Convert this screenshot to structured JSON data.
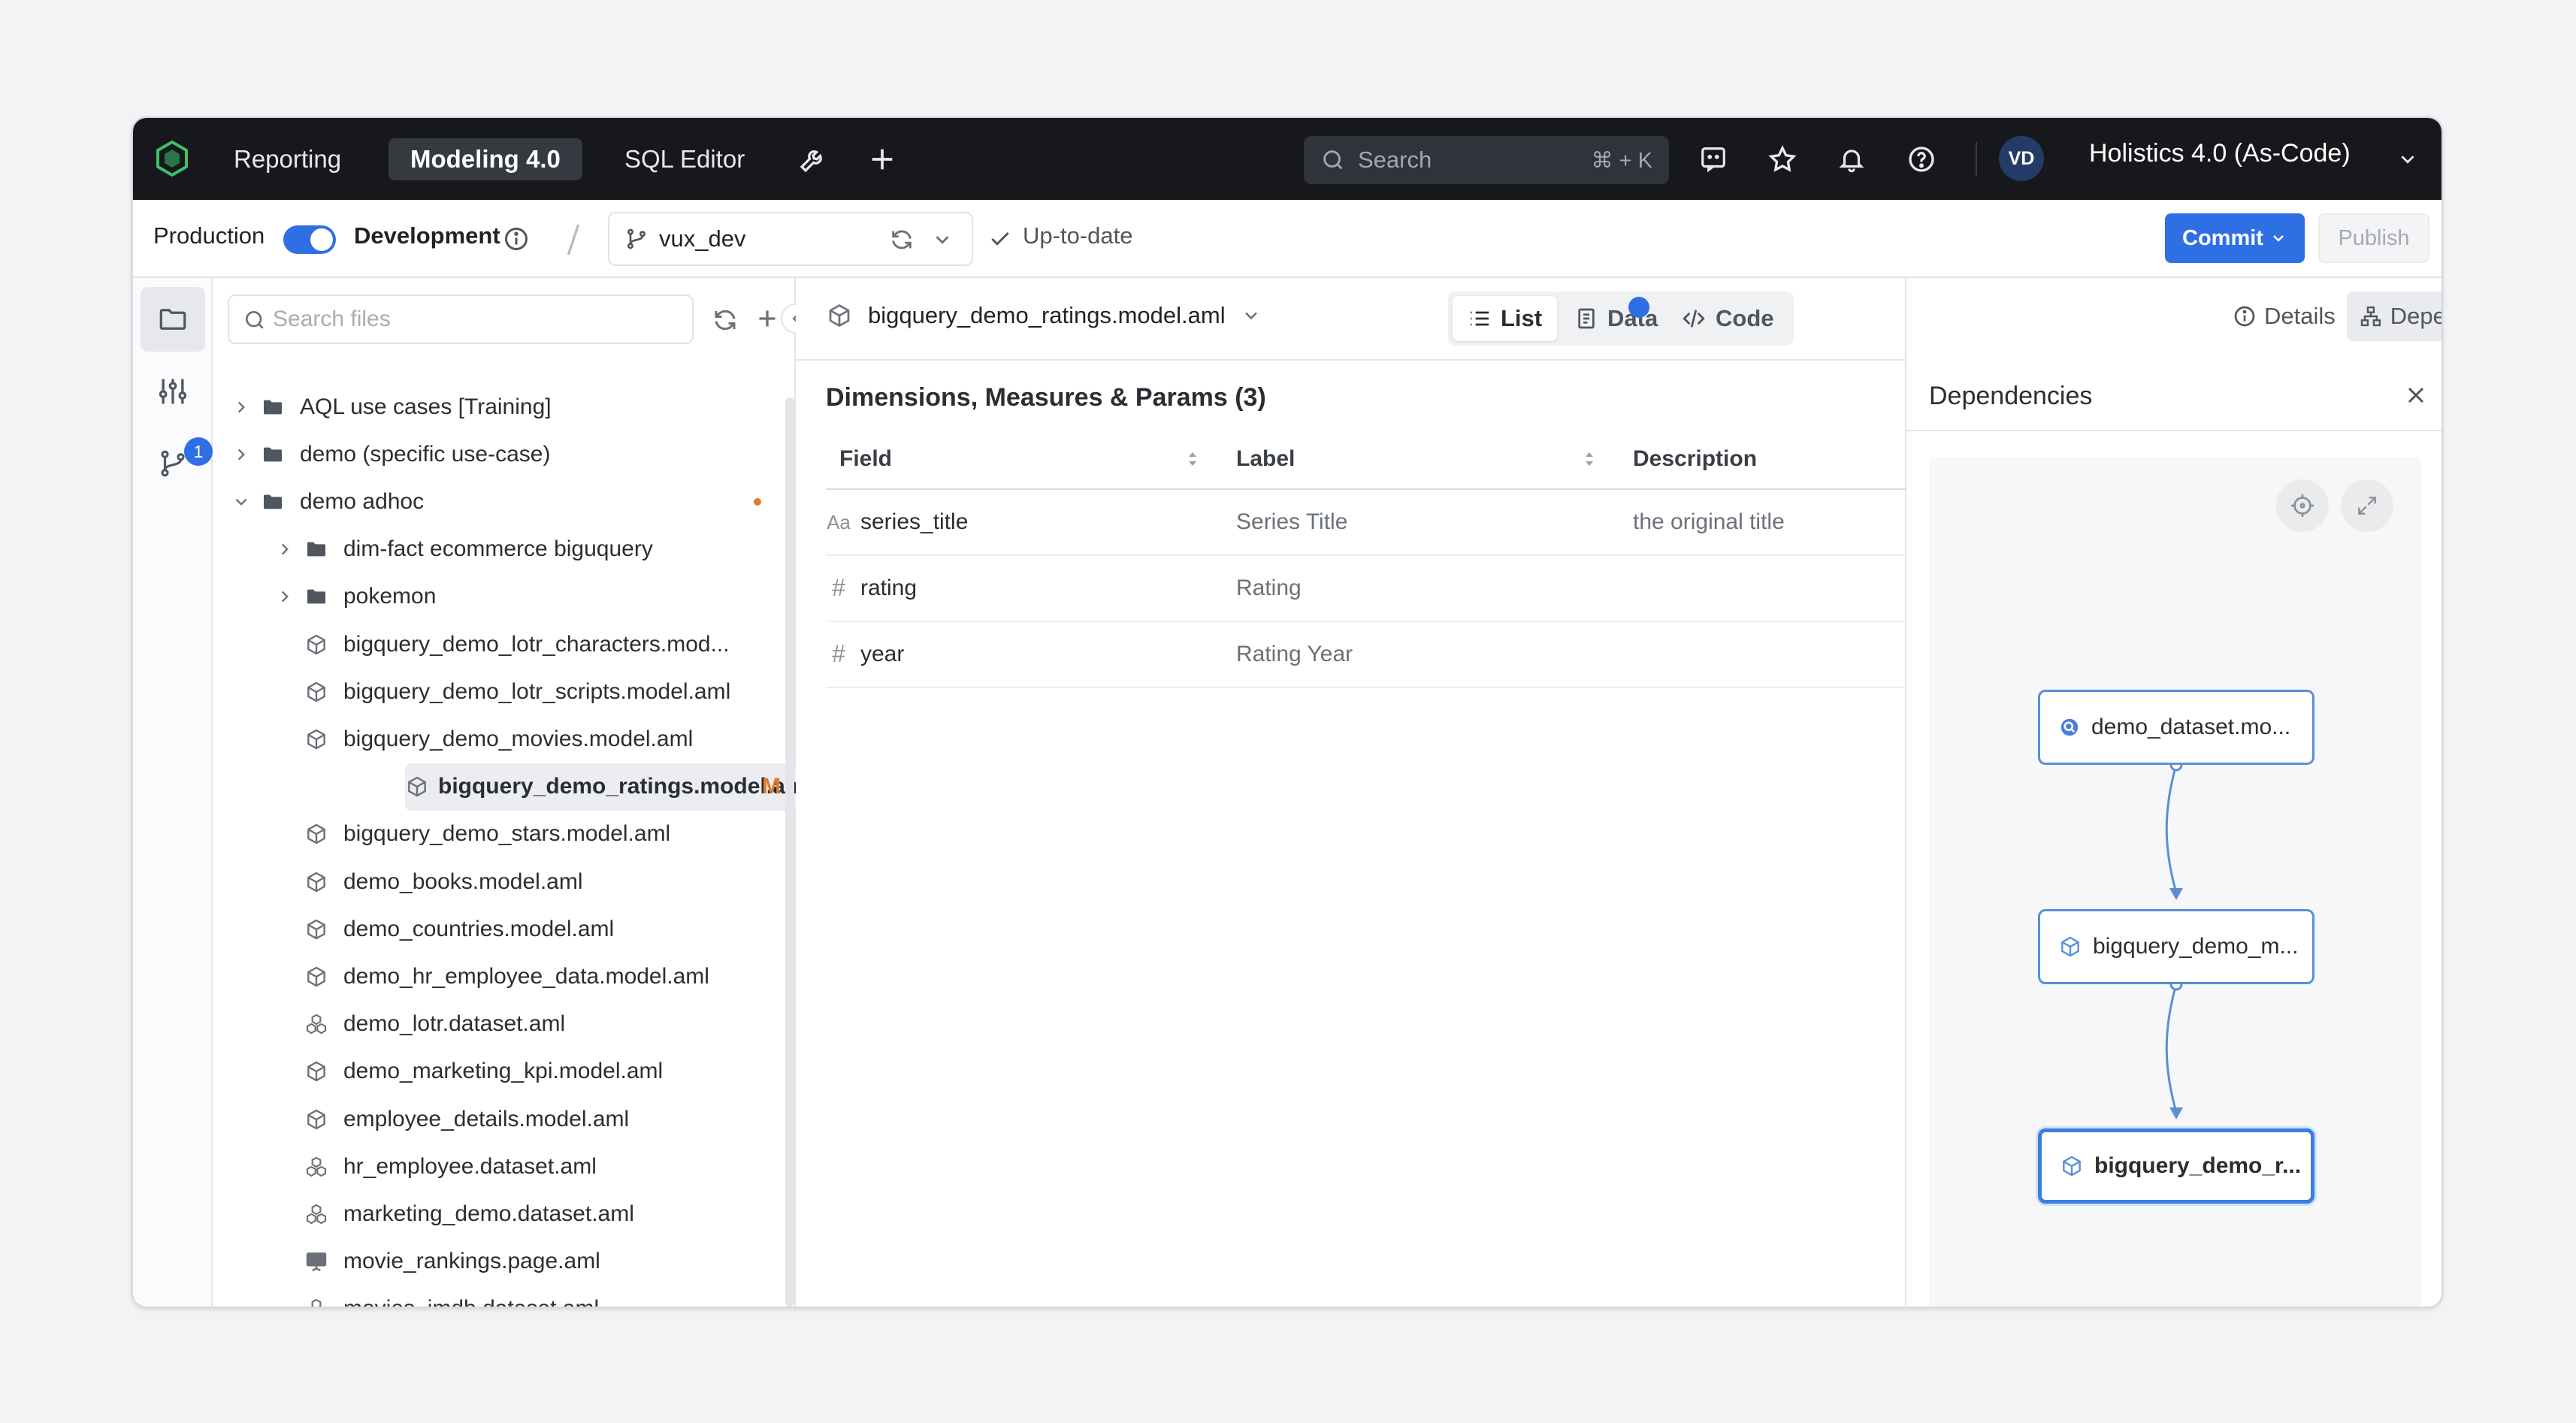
{
  "nav": {
    "tabs": [
      "Reporting",
      "Modeling 4.0",
      "SQL Editor"
    ],
    "active_tab": "Modeling 4.0",
    "search_placeholder": "Search",
    "search_shortcut": "⌘ + K",
    "avatar_initials": "VD",
    "workspace": "Holistics 4.0 (As-Code)"
  },
  "toolbar": {
    "production_label": "Production",
    "development_label": "Development",
    "branch": "vux_dev",
    "status": "Up-to-date",
    "commit_label": "Commit",
    "publish_label": "Publish"
  },
  "rail": {
    "badge_count": "1"
  },
  "files": {
    "search_placeholder": "Search files",
    "items": [
      {
        "name": "AQL use cases [Training]",
        "type": "folder",
        "level": 0,
        "expanded": false
      },
      {
        "name": "demo (specific use-case)",
        "type": "folder",
        "level": 0,
        "expanded": false
      },
      {
        "name": "demo adhoc",
        "type": "folder",
        "level": 0,
        "expanded": true,
        "modified_dot": true
      },
      {
        "name": "dim-fact ecommerce biguquery",
        "type": "folder",
        "level": 1,
        "expanded": false
      },
      {
        "name": "pokemon",
        "type": "folder",
        "level": 1,
        "expanded": false
      },
      {
        "name": "bigquery_demo_lotr_characters.mod...",
        "type": "model",
        "level": 1
      },
      {
        "name": "bigquery_demo_lotr_scripts.model.aml",
        "type": "model",
        "level": 1
      },
      {
        "name": "bigquery_demo_movies.model.aml",
        "type": "model",
        "level": 1
      },
      {
        "name": "bigquery_demo_ratings.model.aml",
        "type": "model",
        "level": 1,
        "selected": true,
        "flag": "M"
      },
      {
        "name": "bigquery_demo_stars.model.aml",
        "type": "model",
        "level": 1
      },
      {
        "name": "demo_books.model.aml",
        "type": "model",
        "level": 1
      },
      {
        "name": "demo_countries.model.aml",
        "type": "model",
        "level": 1
      },
      {
        "name": "demo_hr_employee_data.model.aml",
        "type": "model",
        "level": 1
      },
      {
        "name": "demo_lotr.dataset.aml",
        "type": "dataset",
        "level": 1
      },
      {
        "name": "demo_marketing_kpi.model.aml",
        "type": "model",
        "level": 1
      },
      {
        "name": "employee_details.model.aml",
        "type": "model",
        "level": 1
      },
      {
        "name": "hr_employee.dataset.aml",
        "type": "dataset",
        "level": 1
      },
      {
        "name": "marketing_demo.dataset.aml",
        "type": "dataset",
        "level": 1
      },
      {
        "name": "movie_rankings.page.aml",
        "type": "page",
        "level": 1
      },
      {
        "name": "movies_imdb.dataset.aml",
        "type": "dataset",
        "level": 1
      }
    ]
  },
  "editor": {
    "file_title": "bigquery_demo_ratings.model.aml",
    "views": [
      "List",
      "Data",
      "Code"
    ],
    "active_view": "List",
    "section_title": "Dimensions, Measures & Params (3)",
    "columns": [
      "Field",
      "Label",
      "Description"
    ],
    "rows": [
      {
        "type_glyph": "Aa",
        "field": "series_title",
        "label": "Series Title",
        "description": "the original title"
      },
      {
        "type_glyph": "#",
        "field": "rating",
        "label": "Rating",
        "description": ""
      },
      {
        "type_glyph": "#",
        "field": "year",
        "label": "Rating Year",
        "description": ""
      }
    ]
  },
  "right": {
    "details_label": "Details",
    "dependencies_label": "Dependencies",
    "panel_title": "Dependencies",
    "nodes": [
      "demo_dataset.mo...",
      "bigquery_demo_m...",
      "bigquery_demo_r..."
    ]
  },
  "colors": {
    "accent": "#2f6fe4",
    "modified": "#e07b2c",
    "nav_bg": "#16181b"
  }
}
